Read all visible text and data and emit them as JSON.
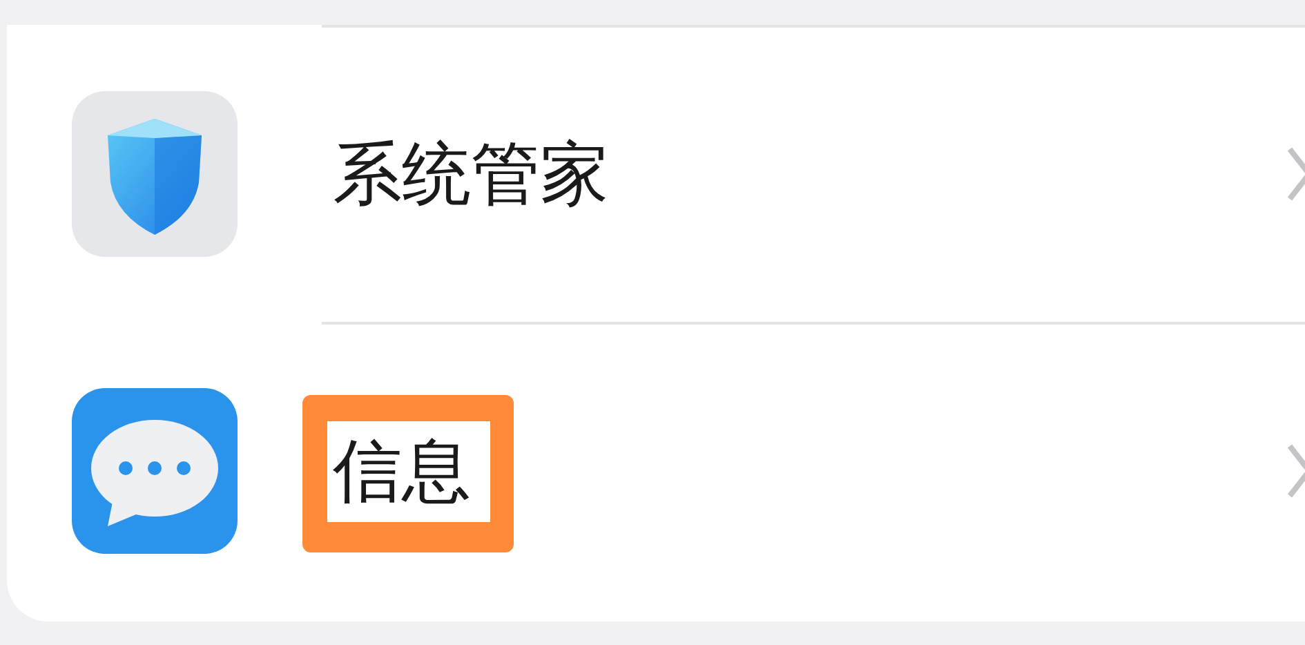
{
  "items": [
    {
      "kind": "shield",
      "label": "系统管家",
      "highlighted": false
    },
    {
      "kind": "messages",
      "label": "信息",
      "highlighted": true
    }
  ]
}
